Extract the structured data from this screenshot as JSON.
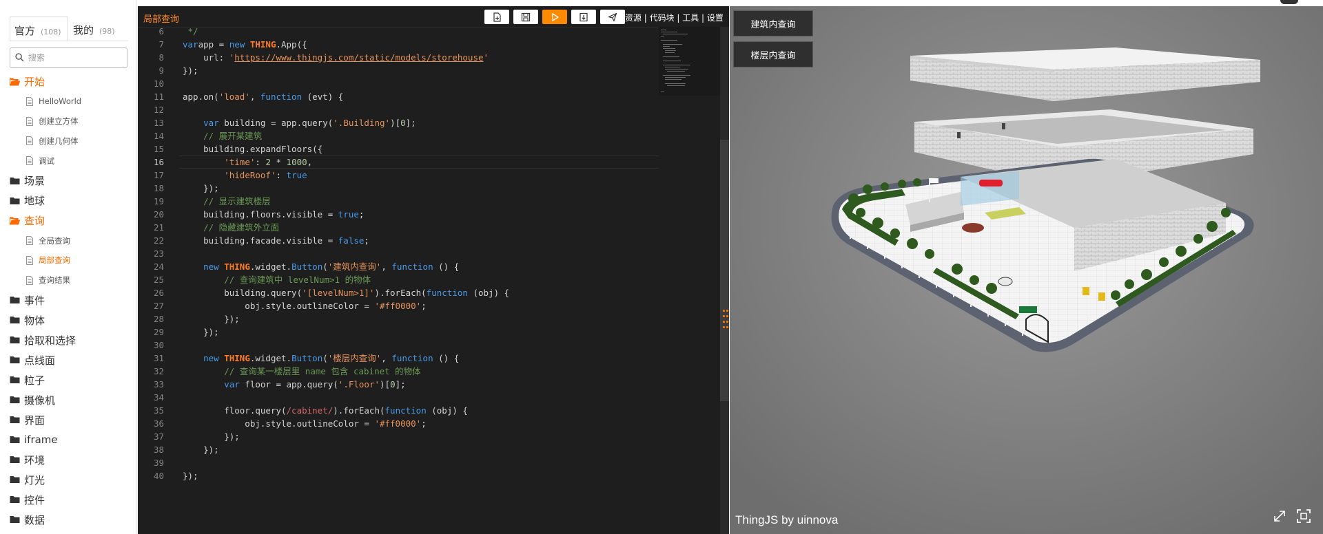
{
  "sidebar": {
    "tabs": [
      {
        "label": "官方",
        "count": "(108)"
      },
      {
        "label": "我的",
        "count": "(98)"
      }
    ],
    "search_placeholder": "搜索",
    "items": [
      {
        "label": "开始",
        "type": "folder",
        "open": true,
        "active": true
      },
      {
        "label": "HelloWorld",
        "type": "file"
      },
      {
        "label": "创建立方体",
        "type": "file"
      },
      {
        "label": "创建几何体",
        "type": "file"
      },
      {
        "label": "调试",
        "type": "file"
      },
      {
        "label": "场景",
        "type": "folder"
      },
      {
        "label": "地球",
        "type": "folder"
      },
      {
        "label": "查询",
        "type": "folder",
        "open": true,
        "active": true
      },
      {
        "label": "全局查询",
        "type": "file"
      },
      {
        "label": "局部查询",
        "type": "file",
        "active": true
      },
      {
        "label": "查询结果",
        "type": "file"
      },
      {
        "label": "事件",
        "type": "folder"
      },
      {
        "label": "物体",
        "type": "folder"
      },
      {
        "label": "拾取和选择",
        "type": "folder"
      },
      {
        "label": "点线面",
        "type": "folder"
      },
      {
        "label": "粒子",
        "type": "folder"
      },
      {
        "label": "摄像机",
        "type": "folder"
      },
      {
        "label": "界面",
        "type": "folder"
      },
      {
        "label": "iframe",
        "type": "folder"
      },
      {
        "label": "环境",
        "type": "folder"
      },
      {
        "label": "灯光",
        "type": "folder"
      },
      {
        "label": "控件",
        "type": "folder"
      },
      {
        "label": "数据",
        "type": "folder"
      }
    ]
  },
  "editor": {
    "title": "局部查询",
    "toolbar_icons": [
      "new-file-icon",
      "save-icon",
      "run-icon",
      "export-icon",
      "share-icon"
    ],
    "links": "|| 资源 | 代码块 | 工具 | 设置",
    "current_line": 16,
    "lines": [
      {
        "n": "6",
        "t": [
          [
            "cm",
            " */"
          ]
        ]
      },
      {
        "n": "7",
        "t": [
          [
            "kw",
            "var"
          ],
          [
            "",
            "app = "
          ],
          [
            "kw",
            "new "
          ],
          [
            "obj",
            "THING"
          ],
          [
            "",
            ".App({"
          ]
        ]
      },
      {
        "n": "8",
        "t": [
          [
            "",
            "    url: "
          ],
          [
            "str",
            "'"
          ],
          [
            "url",
            "https://www.thingjs.com/static/models/storehouse"
          ],
          [
            "str",
            "'"
          ]
        ]
      },
      {
        "n": "9",
        "t": [
          [
            "",
            "});"
          ]
        ]
      },
      {
        "n": "10",
        "t": [
          [
            "",
            ""
          ]
        ]
      },
      {
        "n": "11",
        "t": [
          [
            "",
            "app.on("
          ],
          [
            "str",
            "'load'"
          ],
          [
            "",
            ", "
          ],
          [
            "kw",
            "function"
          ],
          [
            "",
            " (evt) {"
          ]
        ]
      },
      {
        "n": "12",
        "t": [
          [
            "",
            ""
          ]
        ]
      },
      {
        "n": "13",
        "t": [
          [
            "",
            "    "
          ],
          [
            "kw",
            "var"
          ],
          [
            "",
            " building = app.query("
          ],
          [
            "str",
            "'.Building'"
          ],
          [
            "",
            ")["
          ],
          [
            "num",
            "0"
          ],
          [
            "",
            "];"
          ]
        ]
      },
      {
        "n": "14",
        "t": [
          [
            "cm",
            "    // 展开某建筑"
          ]
        ]
      },
      {
        "n": "15",
        "t": [
          [
            "",
            "    building.expandFloors({"
          ]
        ]
      },
      {
        "n": "16",
        "t": [
          [
            "",
            "        "
          ],
          [
            "str",
            "'time'"
          ],
          [
            "",
            ": "
          ],
          [
            "num",
            "2"
          ],
          [
            "",
            " * "
          ],
          [
            "num",
            "1000"
          ],
          [
            "",
            ","
          ]
        ]
      },
      {
        "n": "17",
        "t": [
          [
            "",
            "        "
          ],
          [
            "str",
            "'hideRoof'"
          ],
          [
            "",
            ": "
          ],
          [
            "kw",
            "true"
          ]
        ]
      },
      {
        "n": "18",
        "t": [
          [
            "",
            "    });"
          ]
        ]
      },
      {
        "n": "19",
        "t": [
          [
            "cm",
            "    // 显示建筑楼层"
          ]
        ]
      },
      {
        "n": "20",
        "t": [
          [
            "",
            "    building.floors.visible = "
          ],
          [
            "kw",
            "true"
          ],
          [
            "",
            ";"
          ]
        ]
      },
      {
        "n": "21",
        "t": [
          [
            "cm",
            "    // 隐藏建筑外立面"
          ]
        ]
      },
      {
        "n": "22",
        "t": [
          [
            "",
            "    building.facade.visible = "
          ],
          [
            "kw",
            "false"
          ],
          [
            "",
            ";"
          ]
        ]
      },
      {
        "n": "23",
        "t": [
          [
            "",
            ""
          ]
        ]
      },
      {
        "n": "24",
        "t": [
          [
            "",
            "    "
          ],
          [
            "kw",
            "new "
          ],
          [
            "obj",
            "THING"
          ],
          [
            "",
            ".widget."
          ],
          [
            "kw",
            "Button"
          ],
          [
            "",
            "("
          ],
          [
            "str",
            "'建筑内查询'"
          ],
          [
            "",
            ", "
          ],
          [
            "kw",
            "function"
          ],
          [
            "",
            " () {"
          ]
        ]
      },
      {
        "n": "25",
        "t": [
          [
            "cm",
            "        // 查询建筑中 levelNum>1 的物体"
          ]
        ]
      },
      {
        "n": "26",
        "t": [
          [
            "",
            "        building.query("
          ],
          [
            "str",
            "'[levelNum>1]'"
          ],
          [
            "",
            ").forEach("
          ],
          [
            "kw",
            "function"
          ],
          [
            "",
            " (obj) {"
          ]
        ]
      },
      {
        "n": "27",
        "t": [
          [
            "",
            "            obj.style.outlineColor = "
          ],
          [
            "str",
            "'#ff0000'"
          ],
          [
            "",
            ";"
          ]
        ]
      },
      {
        "n": "28",
        "t": [
          [
            "",
            "        });"
          ]
        ]
      },
      {
        "n": "29",
        "t": [
          [
            "",
            "    });"
          ]
        ]
      },
      {
        "n": "30",
        "t": [
          [
            "",
            ""
          ]
        ]
      },
      {
        "n": "31",
        "t": [
          [
            "",
            "    "
          ],
          [
            "kw",
            "new "
          ],
          [
            "obj",
            "THING"
          ],
          [
            "",
            ".widget."
          ],
          [
            "kw",
            "Button"
          ],
          [
            "",
            "("
          ],
          [
            "str",
            "'楼层内查询'"
          ],
          [
            "",
            ", "
          ],
          [
            "kw",
            "function"
          ],
          [
            "",
            " () {"
          ]
        ]
      },
      {
        "n": "32",
        "t": [
          [
            "cm",
            "        // 查询某一楼层里 name 包含 cabinet 的物体"
          ]
        ]
      },
      {
        "n": "33",
        "t": [
          [
            "",
            "        "
          ],
          [
            "kw",
            "var"
          ],
          [
            "",
            " floor = app.query("
          ],
          [
            "str",
            "'.Floor'"
          ],
          [
            "",
            ")["
          ],
          [
            "num",
            "0"
          ],
          [
            "",
            "];"
          ]
        ]
      },
      {
        "n": "34",
        "t": [
          [
            "",
            ""
          ]
        ]
      },
      {
        "n": "35",
        "t": [
          [
            "",
            "        floor.query("
          ],
          [
            "rx",
            "/cabinet/"
          ],
          [
            "",
            ").forEach("
          ],
          [
            "kw",
            "function"
          ],
          [
            "",
            " (obj) {"
          ]
        ]
      },
      {
        "n": "36",
        "t": [
          [
            "",
            "            obj.style.outlineColor = "
          ],
          [
            "str",
            "'#ff0000'"
          ],
          [
            "",
            ";"
          ]
        ]
      },
      {
        "n": "37",
        "t": [
          [
            "",
            "        });"
          ]
        ]
      },
      {
        "n": "38",
        "t": [
          [
            "",
            "    });"
          ]
        ]
      },
      {
        "n": "39",
        "t": [
          [
            "",
            ""
          ]
        ]
      },
      {
        "n": "40",
        "t": [
          [
            "",
            "});"
          ]
        ]
      }
    ]
  },
  "viewport": {
    "buttons": [
      "建筑内查询",
      "楼层内查询"
    ],
    "watermark": "ThingJS by uinnova",
    "icons": [
      "collapse-icon",
      "fullscreen-icon"
    ]
  },
  "colors": {
    "accent": "#ff6a00",
    "editor_bg": "#1e1e1e",
    "viewport_bg": "#7c7c7c"
  }
}
